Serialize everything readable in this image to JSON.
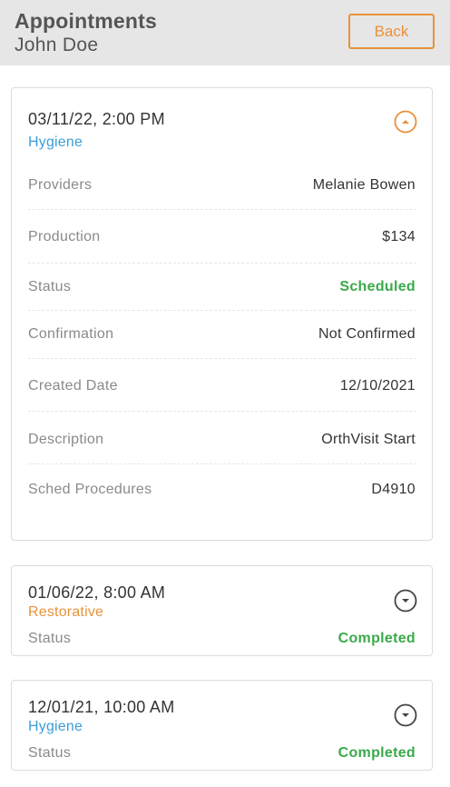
{
  "header": {
    "title": "Appointments",
    "subtitle": "John Doe",
    "back_label": "Back"
  },
  "colors": {
    "accent_orange": "#e8923a",
    "hygiene_blue": "#3a9fd6",
    "restorative_orange": "#e8923a",
    "status_green": "#3aaa4a"
  },
  "appointments": [
    {
      "datetime": "03/11/22, 2:00 PM",
      "type": "Hygiene",
      "expanded": true,
      "toggle_icon": "chevron-up-circle-icon",
      "details": [
        {
          "label": "Providers",
          "value": "Melanie Bowen"
        },
        {
          "label": "Production",
          "value": "$134"
        },
        {
          "label": "Status",
          "value": "Scheduled"
        },
        {
          "label": "Confirmation",
          "value": "Not Confirmed"
        },
        {
          "label": "Created Date",
          "value": "12/10/2021"
        },
        {
          "label": "Description",
          "value": "OrthVisit Start"
        },
        {
          "label": "Sched Procedures",
          "value": "D4910"
        }
      ]
    },
    {
      "datetime": "01/06/22, 8:00 AM",
      "type": "Restorative",
      "expanded": false,
      "toggle_icon": "chevron-down-circle-icon",
      "status_label": "Status",
      "status_value": "Completed"
    },
    {
      "datetime": "12/01/21, 10:00 AM",
      "type": "Hygiene",
      "expanded": false,
      "toggle_icon": "chevron-down-circle-icon",
      "status_label": "Status",
      "status_value": "Completed"
    }
  ]
}
